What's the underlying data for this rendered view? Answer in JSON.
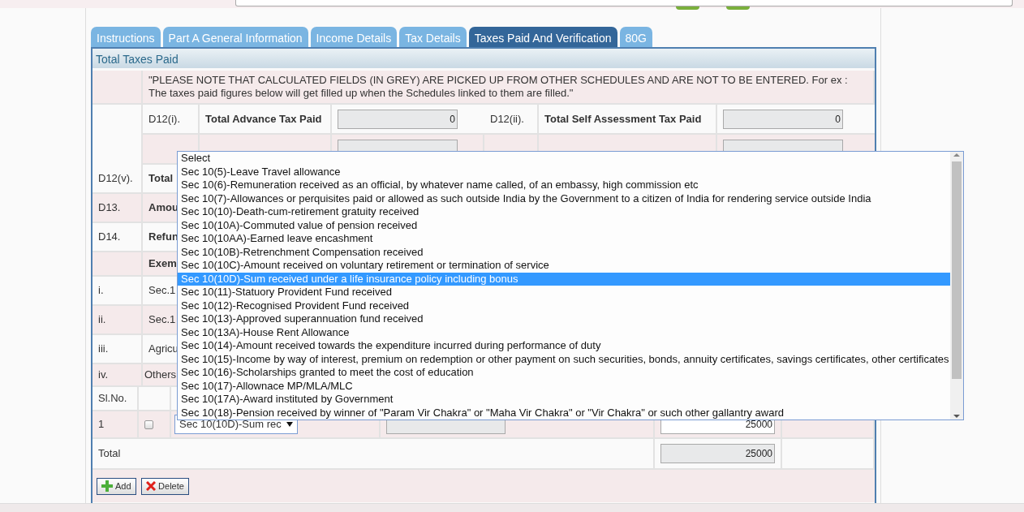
{
  "tabs": [
    {
      "label": "Instructions",
      "selected": false
    },
    {
      "label": "Part A General Information",
      "selected": false
    },
    {
      "label": "Income Details",
      "selected": false
    },
    {
      "label": "Tax Details",
      "selected": false
    },
    {
      "label": "Taxes Paid And Verification",
      "selected": true
    },
    {
      "label": "80G",
      "selected": false
    }
  ],
  "panel": {
    "title": "Total Taxes Paid",
    "rows": [
      {
        "kind": "note",
        "text": "\"PLEASE NOTE THAT CALCULATED FIELDS (IN GREY) ARE PICKED UP FROM OTHER SCHEDULES AND ARE NOT TO BE ENTERED. For ex : The taxes paid figures below will get filled up when the Schedules linked to them are filled.\""
      },
      {
        "kind": "pair",
        "cells": [
          {
            "code": "D12(i).",
            "label": "Total Advance Tax Paid",
            "value": "0"
          },
          {
            "code": "D12(ii).",
            "label": "Total Self Assessment Tax Paid",
            "value": "0"
          }
        ]
      },
      {
        "kind": "covered"
      },
      {
        "kind": "line",
        "code": "D12(v).",
        "label": "Total",
        "strong": true
      },
      {
        "kind": "line",
        "code": "D13.",
        "label": "Amou",
        "strong": true
      },
      {
        "kind": "line",
        "code": "D14.",
        "label": "Refun",
        "strong": true
      },
      {
        "kind": "heading",
        "label": "Exem"
      },
      {
        "kind": "line",
        "code": "i.",
        "label": "Sec.1",
        "strong": false
      },
      {
        "kind": "line",
        "code": "ii.",
        "label": "Sec.1",
        "strong": false
      },
      {
        "kind": "line",
        "code": "iii.",
        "label": "Agricu",
        "strong": false
      },
      {
        "kind": "subline",
        "code": "iv.",
        "label": "Others",
        "strong": false
      }
    ],
    "others_table": {
      "header": "Sl.No.",
      "entries": [
        {
          "sl": "1",
          "checked": false,
          "section": "Sec 10(10D)-Sum rec",
          "amount": "25000"
        }
      ],
      "total": {
        "label": "Total",
        "value": "25000"
      }
    },
    "buttons": [
      {
        "kind": "add",
        "label": "Add"
      },
      {
        "kind": "delete",
        "label": "Delete"
      }
    ],
    "dropdown": {
      "options": [
        {
          "label": "Select",
          "selected": false
        },
        {
          "label": "Sec 10(5)-Leave Travel allowance",
          "selected": false
        },
        {
          "label": "Sec 10(6)-Remuneration received as an official, by whatever name called, of an embassy, high commission etc",
          "selected": false
        },
        {
          "label": "Sec 10(7)-Allowances or perquisites paid or allowed as such outside India by the Government to a citizen of India for rendering service outside India",
          "selected": false
        },
        {
          "label": "Sec 10(10)-Death-cum-retirement gratuity received",
          "selected": false
        },
        {
          "label": "Sec 10(10A)-Commuted value of pension received",
          "selected": false
        },
        {
          "label": "Sec 10(10AA)-Earned leave encashment",
          "selected": false
        },
        {
          "label": "Sec 10(10B)-Retrenchment Compensation received",
          "selected": false
        },
        {
          "label": "Sec 10(10C)-Amount received on voluntary retirement or termination of service",
          "selected": false
        },
        {
          "label": "Sec 10(10D)-Sum received under a life insurance policy including bonus",
          "selected": true
        },
        {
          "label": "Sec 10(11)-Statuory Provident Fund received",
          "selected": false
        },
        {
          "label": "Sec 10(12)-Recognised Provident Fund received",
          "selected": false
        },
        {
          "label": "Sec 10(13)-Approved superannuation fund received",
          "selected": false
        },
        {
          "label": "Sec 10(13A)-House Rent Allowance",
          "selected": false
        },
        {
          "label": "Sec 10(14)-Amount received towards the expenditure incurred during performance of duty",
          "selected": false
        },
        {
          "label": "Sec 10(15)-Income by way of interest, premium on redemption or other payment on such securities, bonds, annuity certificates, savings certificates, other certificates",
          "selected": false
        },
        {
          "label": "Sec 10(16)-Scholarships granted to meet the cost of education",
          "selected": false
        },
        {
          "label": "Sec 10(17)-Allownace MP/MLA/MLC",
          "selected": false
        },
        {
          "label": "Sec 10(17A)-Award instituted by Government",
          "selected": false
        },
        {
          "label": "Sec 10(18)-Pension received by winner of \"Param Vir Chakra\" or \"Maha Vir Chakra\" or \"Vir Chakra\" or such other gallantry award",
          "selected": false
        }
      ]
    }
  }
}
